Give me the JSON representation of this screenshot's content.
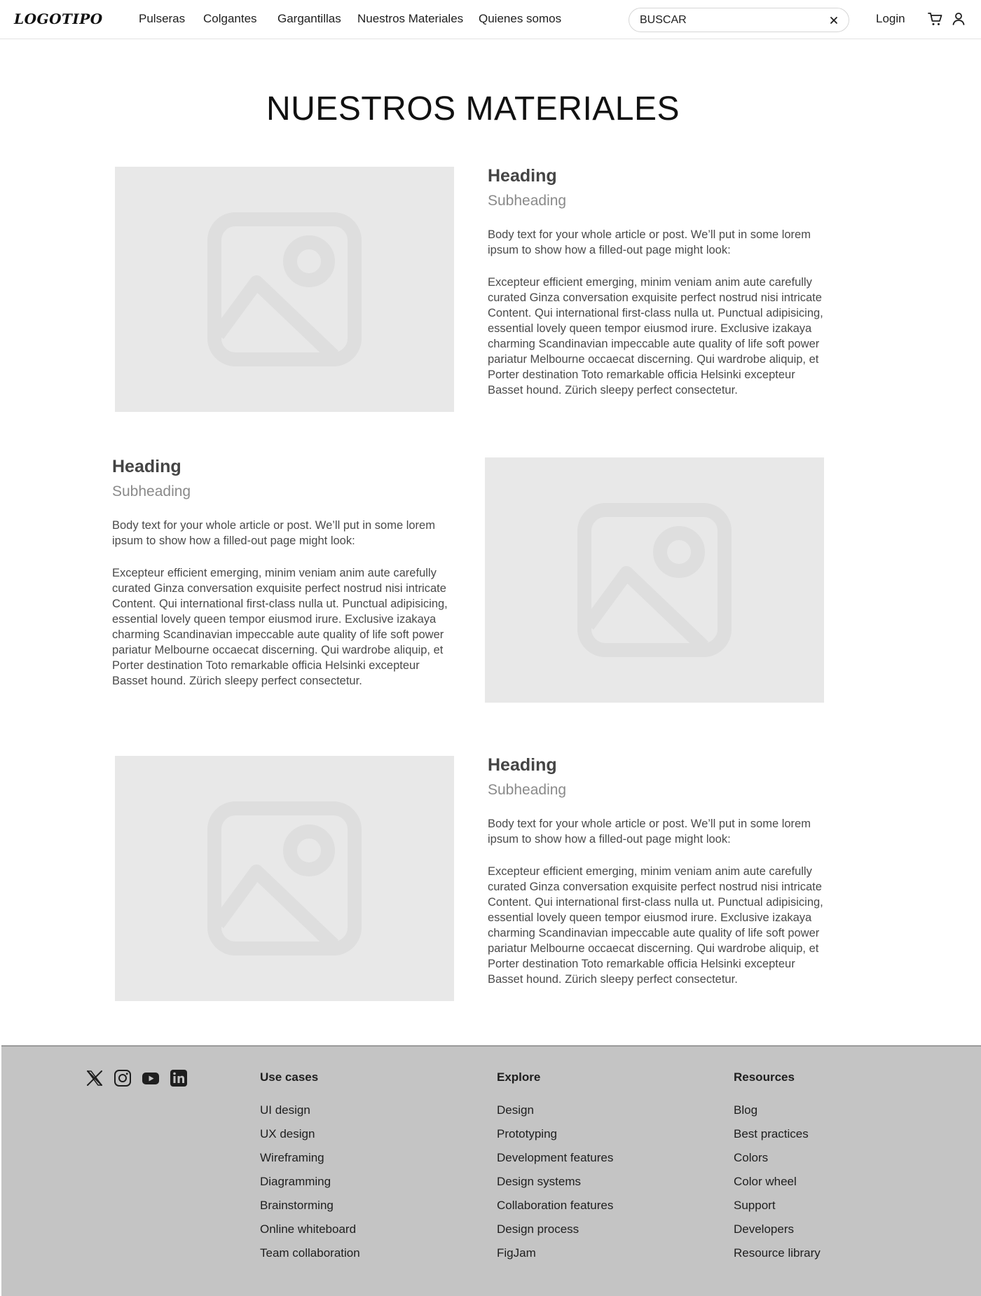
{
  "header": {
    "logo": "LOGOTIPO",
    "nav": [
      "Pulseras",
      "Colgantes",
      "Gargantillas",
      "Nuestros Materiales",
      "Quienes somos"
    ],
    "search_value": "BUSCAR",
    "login": "Login",
    "icons": [
      "close-icon",
      "cart-icon",
      "user-icon"
    ]
  },
  "main": {
    "title": "NUESTROS MATERIALES",
    "articles": [
      {
        "heading": "Heading",
        "subheading": "Subheading",
        "body1": "Body text for your whole article or post. We’ll put in some lorem ipsum to show how a filled-out page might look:",
        "body2": "Excepteur efficient emerging, minim veniam anim aute carefully curated Ginza conversation exquisite perfect nostrud nisi intricate Content. Qui  international first-class nulla ut. Punctual adipisicing, essential lovely queen tempor eiusmod irure. Exclusive izakaya charming Scandinavian impeccable aute quality of life soft power pariatur Melbourne occaecat discerning. Qui wardrobe aliquip, et Porter destination Toto remarkable officia Helsinki excepteur Basset hound. Zürich sleepy perfect consectetur."
      },
      {
        "heading": "Heading",
        "subheading": "Subheading",
        "body1": "Body text for your whole article or post. We’ll put in some lorem ipsum to show how a filled-out page might look:",
        "body2": "Excepteur efficient emerging, minim veniam anim aute carefully curated Ginza conversation exquisite perfect nostrud nisi intricate Content. Qui  international first-class nulla ut. Punctual adipisicing, essential lovely queen tempor eiusmod irure. Exclusive izakaya charming Scandinavian impeccable aute quality of life soft power pariatur Melbourne occaecat discerning. Qui wardrobe aliquip, et Porter destination Toto remarkable officia Helsinki excepteur Basset hound. Zürich sleepy perfect consectetur."
      },
      {
        "heading": "Heading",
        "subheading": "Subheading",
        "body1": "Body text for your whole article or post. We’ll put in some lorem ipsum to show how a filled-out page might look:",
        "body2": "Excepteur efficient emerging, minim veniam anim aute carefully curated Ginza conversation exquisite perfect nostrud nisi intricate Content. Qui  international first-class nulla ut. Punctual adipisicing, essential lovely queen tempor eiusmod irure. Exclusive izakaya charming Scandinavian impeccable aute quality of life soft power pariatur Melbourne occaecat discerning. Qui wardrobe aliquip, et Porter destination Toto remarkable officia Helsinki excepteur Basset hound. Zürich sleepy perfect consectetur."
      }
    ]
  },
  "footer": {
    "social_icons": [
      "x-icon",
      "instagram-icon",
      "youtube-icon",
      "linkedin-icon"
    ],
    "columns": [
      {
        "title": "Use cases",
        "links": [
          "UI design",
          "UX design",
          "Wireframing",
          "Diagramming",
          "Brainstorming",
          "Online whiteboard",
          "Team collaboration"
        ]
      },
      {
        "title": "Explore",
        "links": [
          "Design",
          "Prototyping",
          "Development features",
          "Design systems",
          "Collaboration features",
          "Design process",
          "FigJam"
        ]
      },
      {
        "title": "Resources",
        "links": [
          "Blog",
          "Best practices",
          "Colors",
          "Color wheel",
          "Support",
          "Developers",
          "Resource library"
        ]
      }
    ]
  },
  "colors": {
    "placeholder_bg": "#e8e8e8",
    "placeholder_icon": "#dedede",
    "footer_bg": "#c4c4c4"
  }
}
